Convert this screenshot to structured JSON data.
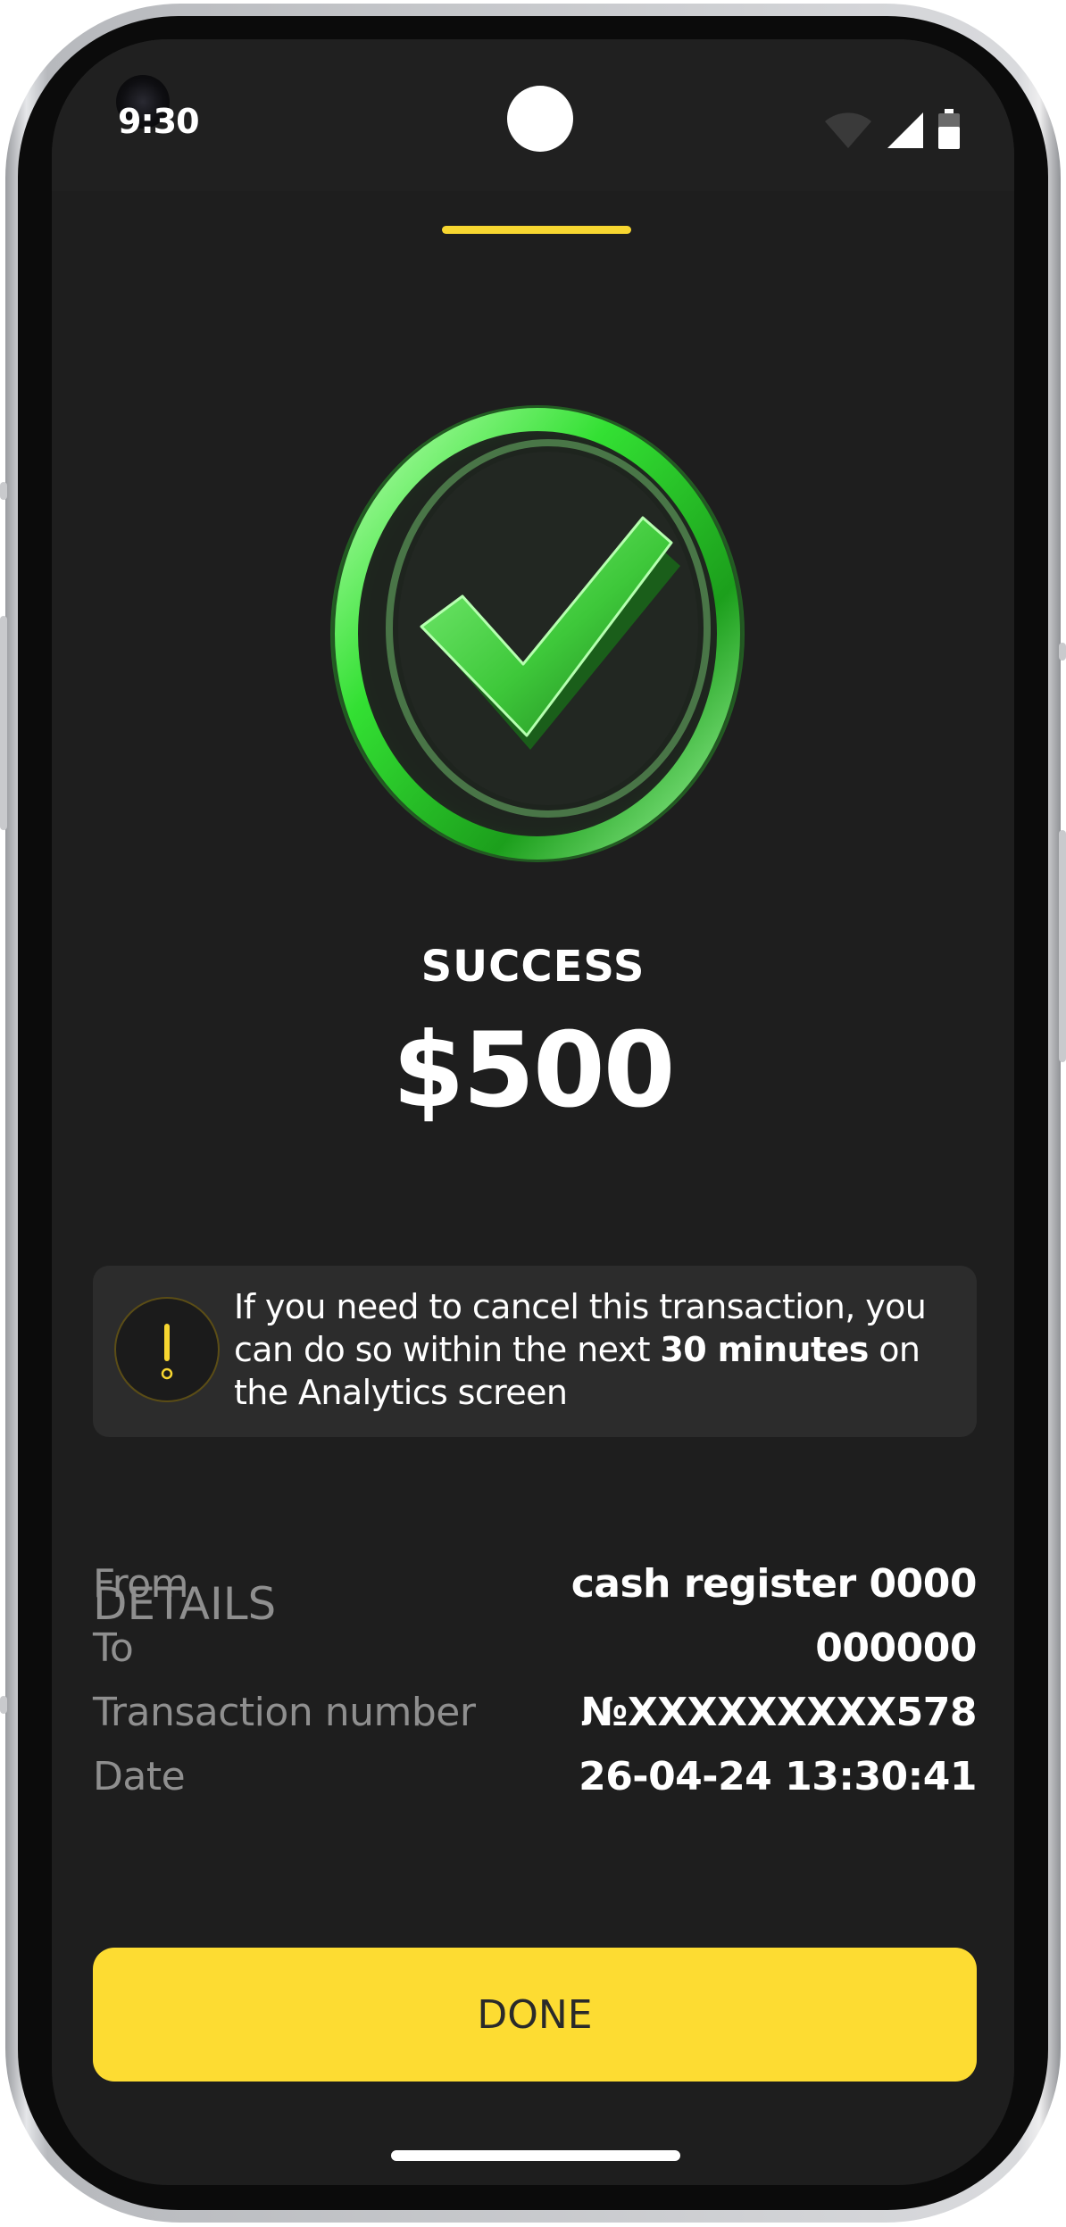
{
  "status_bar": {
    "time": "9:30",
    "icons": [
      "wifi-icon",
      "cellular-signal-icon",
      "battery-icon"
    ]
  },
  "result": {
    "status": "SUCCESS",
    "amount": "$500",
    "icon": "success-check-icon"
  },
  "notice": {
    "icon": "exclamation-icon",
    "text_1": "If you need to cancel this transaction, you can do so within the next ",
    "bold_1": "30 minutes",
    "text_2": " on the Analytics screen"
  },
  "details": {
    "heading": "DETAILS",
    "rows": [
      {
        "label": "From",
        "value": "cash register 0000"
      },
      {
        "label": "To",
        "value": "000000"
      },
      {
        "label": "Transaction number",
        "value": "№XXXXXXXXX578"
      },
      {
        "label": "Date",
        "value": "26-04-24 13:30:41"
      }
    ]
  },
  "actions": {
    "done_label": "DONE"
  },
  "colors": {
    "background": "#1e1e1e",
    "accent": "#fddc32",
    "success": "#3fdc3a",
    "card": "#2c2c2c",
    "muted_text": "#8f8f8f"
  }
}
